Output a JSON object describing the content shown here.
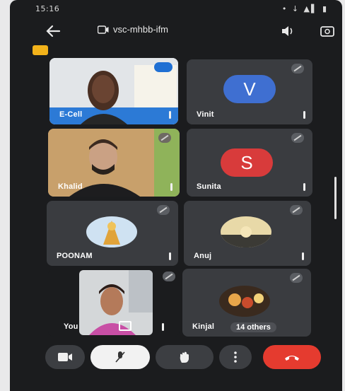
{
  "status_bar": {
    "time": "15:16",
    "icons": "• ↓ ▲▌ ▮"
  },
  "meeting": {
    "code": "vsc-mhbb-ifm"
  },
  "colors": {
    "vinit_avatar": "#3f6fd1",
    "sunita_avatar": "#d83b3b",
    "end_call": "#e53b2f",
    "rec_badge": "#f2b21a"
  },
  "participants": [
    {
      "name": "E-Cell"
    },
    {
      "name": "Vinit",
      "initial": "V"
    },
    {
      "name": "Khalid"
    },
    {
      "name": "Sunita",
      "initial": "S"
    },
    {
      "name": "POONAM"
    },
    {
      "name": "Anuj"
    },
    {
      "name": "You"
    },
    {
      "name": "Kinjal",
      "extra": "14 others"
    }
  ],
  "icons": {
    "back": "back-arrow-icon",
    "speaker": "speaker-icon",
    "switch_camera": "switch-camera-icon",
    "camera": "video-camera-icon",
    "mic_off": "mic-off-icon",
    "raise_hand": "hand-icon",
    "more": "more-vert-icon",
    "end_call": "end-call-icon"
  }
}
